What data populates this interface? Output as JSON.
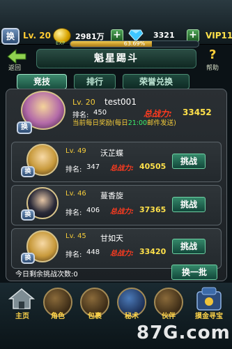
{
  "topbar": {
    "swap_label": "换",
    "level": "Lv. 20",
    "exp_badge": "EXP",
    "gold": "2981万",
    "diamonds": "3321",
    "vip": "VIP11",
    "exp_percent_text": "63.69%",
    "exp_fraction": 0.6369
  },
  "titlebar": {
    "back_label": "返回",
    "title": "魁星踢斗",
    "help_label": "帮助",
    "help_icon": "?"
  },
  "tabs": [
    {
      "label": "竞技",
      "active": true
    },
    {
      "label": "排行",
      "active": false
    },
    {
      "label": "荣誉兑换",
      "active": false
    }
  ],
  "me": {
    "level": "Lv. 20",
    "name": "test001",
    "rank_label": "排名:",
    "rank": "450",
    "power_label": "总战力:",
    "power": "33452",
    "reward_note_a": "当前每日奖励(每日",
    "reward_time": "21:00",
    "reward_note_b": "邮件发送)",
    "swap_label": "换"
  },
  "opponents": [
    {
      "level": "Lv. 49",
      "name": "沃芷蝶",
      "rank_label": "排名:",
      "rank": "347",
      "power_label": "总战力:",
      "power": "40505",
      "button": "挑战",
      "swap_label": "换"
    },
    {
      "level": "Lv. 46",
      "name": "蔓香旋",
      "rank_label": "排名:",
      "rank": "406",
      "power_label": "总战力:",
      "power": "37365",
      "button": "挑战",
      "swap_label": "换"
    },
    {
      "level": "Lv. 45",
      "name": "甘如天",
      "rank_label": "排名:",
      "rank": "448",
      "power_label": "总战力:",
      "power": "33420",
      "button": "挑战",
      "swap_label": "换"
    }
  ],
  "footer": {
    "remaining_label": "今日剩余挑战次数:",
    "remaining": "0",
    "refresh_label": "换一批"
  },
  "bottomnav": [
    {
      "label": "主页",
      "icon": "home-icon"
    },
    {
      "label": "角色",
      "icon": "character-icon"
    },
    {
      "label": "包裹",
      "icon": "bag-icon"
    },
    {
      "label": "秘术",
      "icon": "book-icon"
    },
    {
      "label": "伙伴",
      "icon": "partner-icon"
    },
    {
      "label": "摸金寻宝",
      "icon": "treasure-icon"
    }
  ],
  "watermark": "87G.com",
  "colors": {
    "accent": "#f5cc3a",
    "power": "#ff3b1f",
    "tab_active": "#3e8a6e"
  }
}
